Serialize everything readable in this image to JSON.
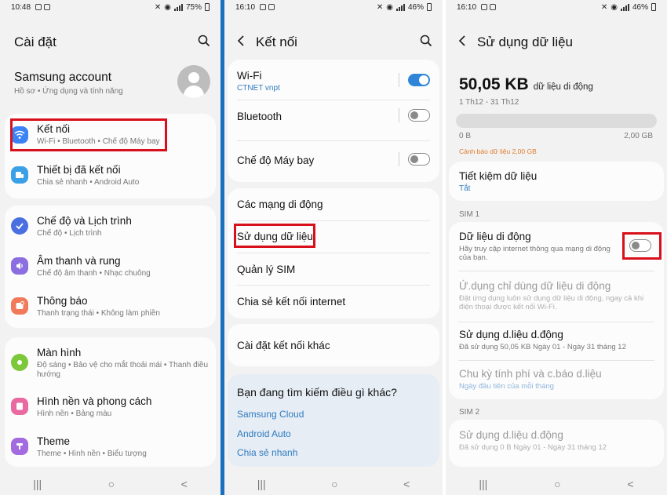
{
  "panel1": {
    "status": {
      "time": "10:48",
      "battery": "75%"
    },
    "title": "Cài đặt",
    "account": {
      "name": "Samsung account",
      "sub": "Hồ sơ  •  Ứng dụng và tính năng"
    },
    "items": [
      {
        "title": "Kết nối",
        "sub": "Wi-Fi  •  Bluetooth  •  Chế độ Máy bay",
        "icon": "wifi-icon",
        "color": "#3b82f6"
      },
      {
        "title": "Thiết bị đã kết nối",
        "sub": "Chia sẻ nhanh  •  Android Auto",
        "icon": "devices-icon",
        "color": "#3aa0e8"
      },
      {
        "title": "Chế độ và Lịch trình",
        "sub": "Chế độ  •  Lịch trình",
        "icon": "modes-icon",
        "color": "#4a6fe0"
      },
      {
        "title": "Âm thanh và rung",
        "sub": "Chế độ âm thanh  •  Nhạc chuông",
        "icon": "sound-icon",
        "color": "#8b6fe0"
      },
      {
        "title": "Thông báo",
        "sub": "Thanh trạng thái  •  Không làm phiền",
        "icon": "notification-icon",
        "color": "#f07a5a"
      },
      {
        "title": "Màn hình",
        "sub": "Độ sáng  •  Bảo vệ cho mắt thoải mái  •  Thanh điều hướng",
        "icon": "display-icon",
        "color": "#7cc83a"
      },
      {
        "title": "Hình nền và phong cách",
        "sub": "Hình nền  •  Bảng màu",
        "icon": "wallpaper-icon",
        "color": "#e86aa0"
      },
      {
        "title": "Theme",
        "sub": "Theme  •  Hình nền  •  Biểu tượng",
        "icon": "theme-icon",
        "color": "#a46ae0"
      }
    ]
  },
  "panel2": {
    "status": {
      "time": "16:10",
      "battery": "46%"
    },
    "title": "Kết nối",
    "wifi": {
      "title": "Wi-Fi",
      "sub": "CTNET vnpt"
    },
    "bluetooth": {
      "title": "Bluetooth"
    },
    "airplane": {
      "title": "Chế độ Máy bay"
    },
    "mobile_networks": "Các mạng di động",
    "data_usage": "Sử dụng dữ liệu",
    "sim_manager": "Quản lý SIM",
    "hotspot": "Chia sẻ kết nối internet",
    "more": "Cài đặt kết nối khác",
    "suggest": {
      "title": "Bạn đang tìm kiếm điều gì khác?",
      "links": [
        "Samsung Cloud",
        "Android Auto",
        "Chia sẻ nhanh"
      ]
    }
  },
  "panel3": {
    "status": {
      "time": "16:10",
      "battery": "46%"
    },
    "title": "Sử dụng dữ liệu",
    "usage": {
      "value": "50,05 KB",
      "unit": "dữ liệu di động",
      "period": "1 Th12 - 31 Th12",
      "min": "0 B",
      "max": "2,00 GB",
      "warning": "Cảnh báo dữ liệu 2,00 GB",
      "fill_fraction": 0.0
    },
    "saver": {
      "title": "Tiết kiệm dữ liệu",
      "sub": "Tắt"
    },
    "sim1_label": "SIM 1",
    "mobile_data": {
      "title": "Dữ liệu di động",
      "sub": "Hãy truy cập internet thông qua mạng di động của bạn."
    },
    "apps_only": {
      "title": "Ứ.dụng chỉ dùng dữ liệu di động",
      "sub": "Đặt ứng dụng luôn sử dụng dữ liệu di động, ngay cả khi điện thoại được kết nối Wi-Fi."
    },
    "usage1": {
      "title": "Sử dụng d.liệu d.động",
      "sub": "Đã sử dụng 50,05 KB Ngày 01 - Ngày 31 tháng 12"
    },
    "billing": {
      "title": "Chu kỳ tính phí và c.báo d.liệu",
      "sub": "Ngày đầu tiên của mỗi tháng"
    },
    "sim2_label": "SIM 2",
    "usage2": {
      "title": "Sử dụng d.liệu d.động",
      "sub": "Đã sử dụng 0 B Ngày 01 - Ngày 31 tháng 12"
    }
  },
  "nav": {
    "recents": "|||",
    "home": "○",
    "back": "<"
  },
  "colors": {
    "accent": "#2f86d8",
    "highlight": "#d8101c",
    "warning": "#e07b2a",
    "link": "#2f7bbf"
  }
}
